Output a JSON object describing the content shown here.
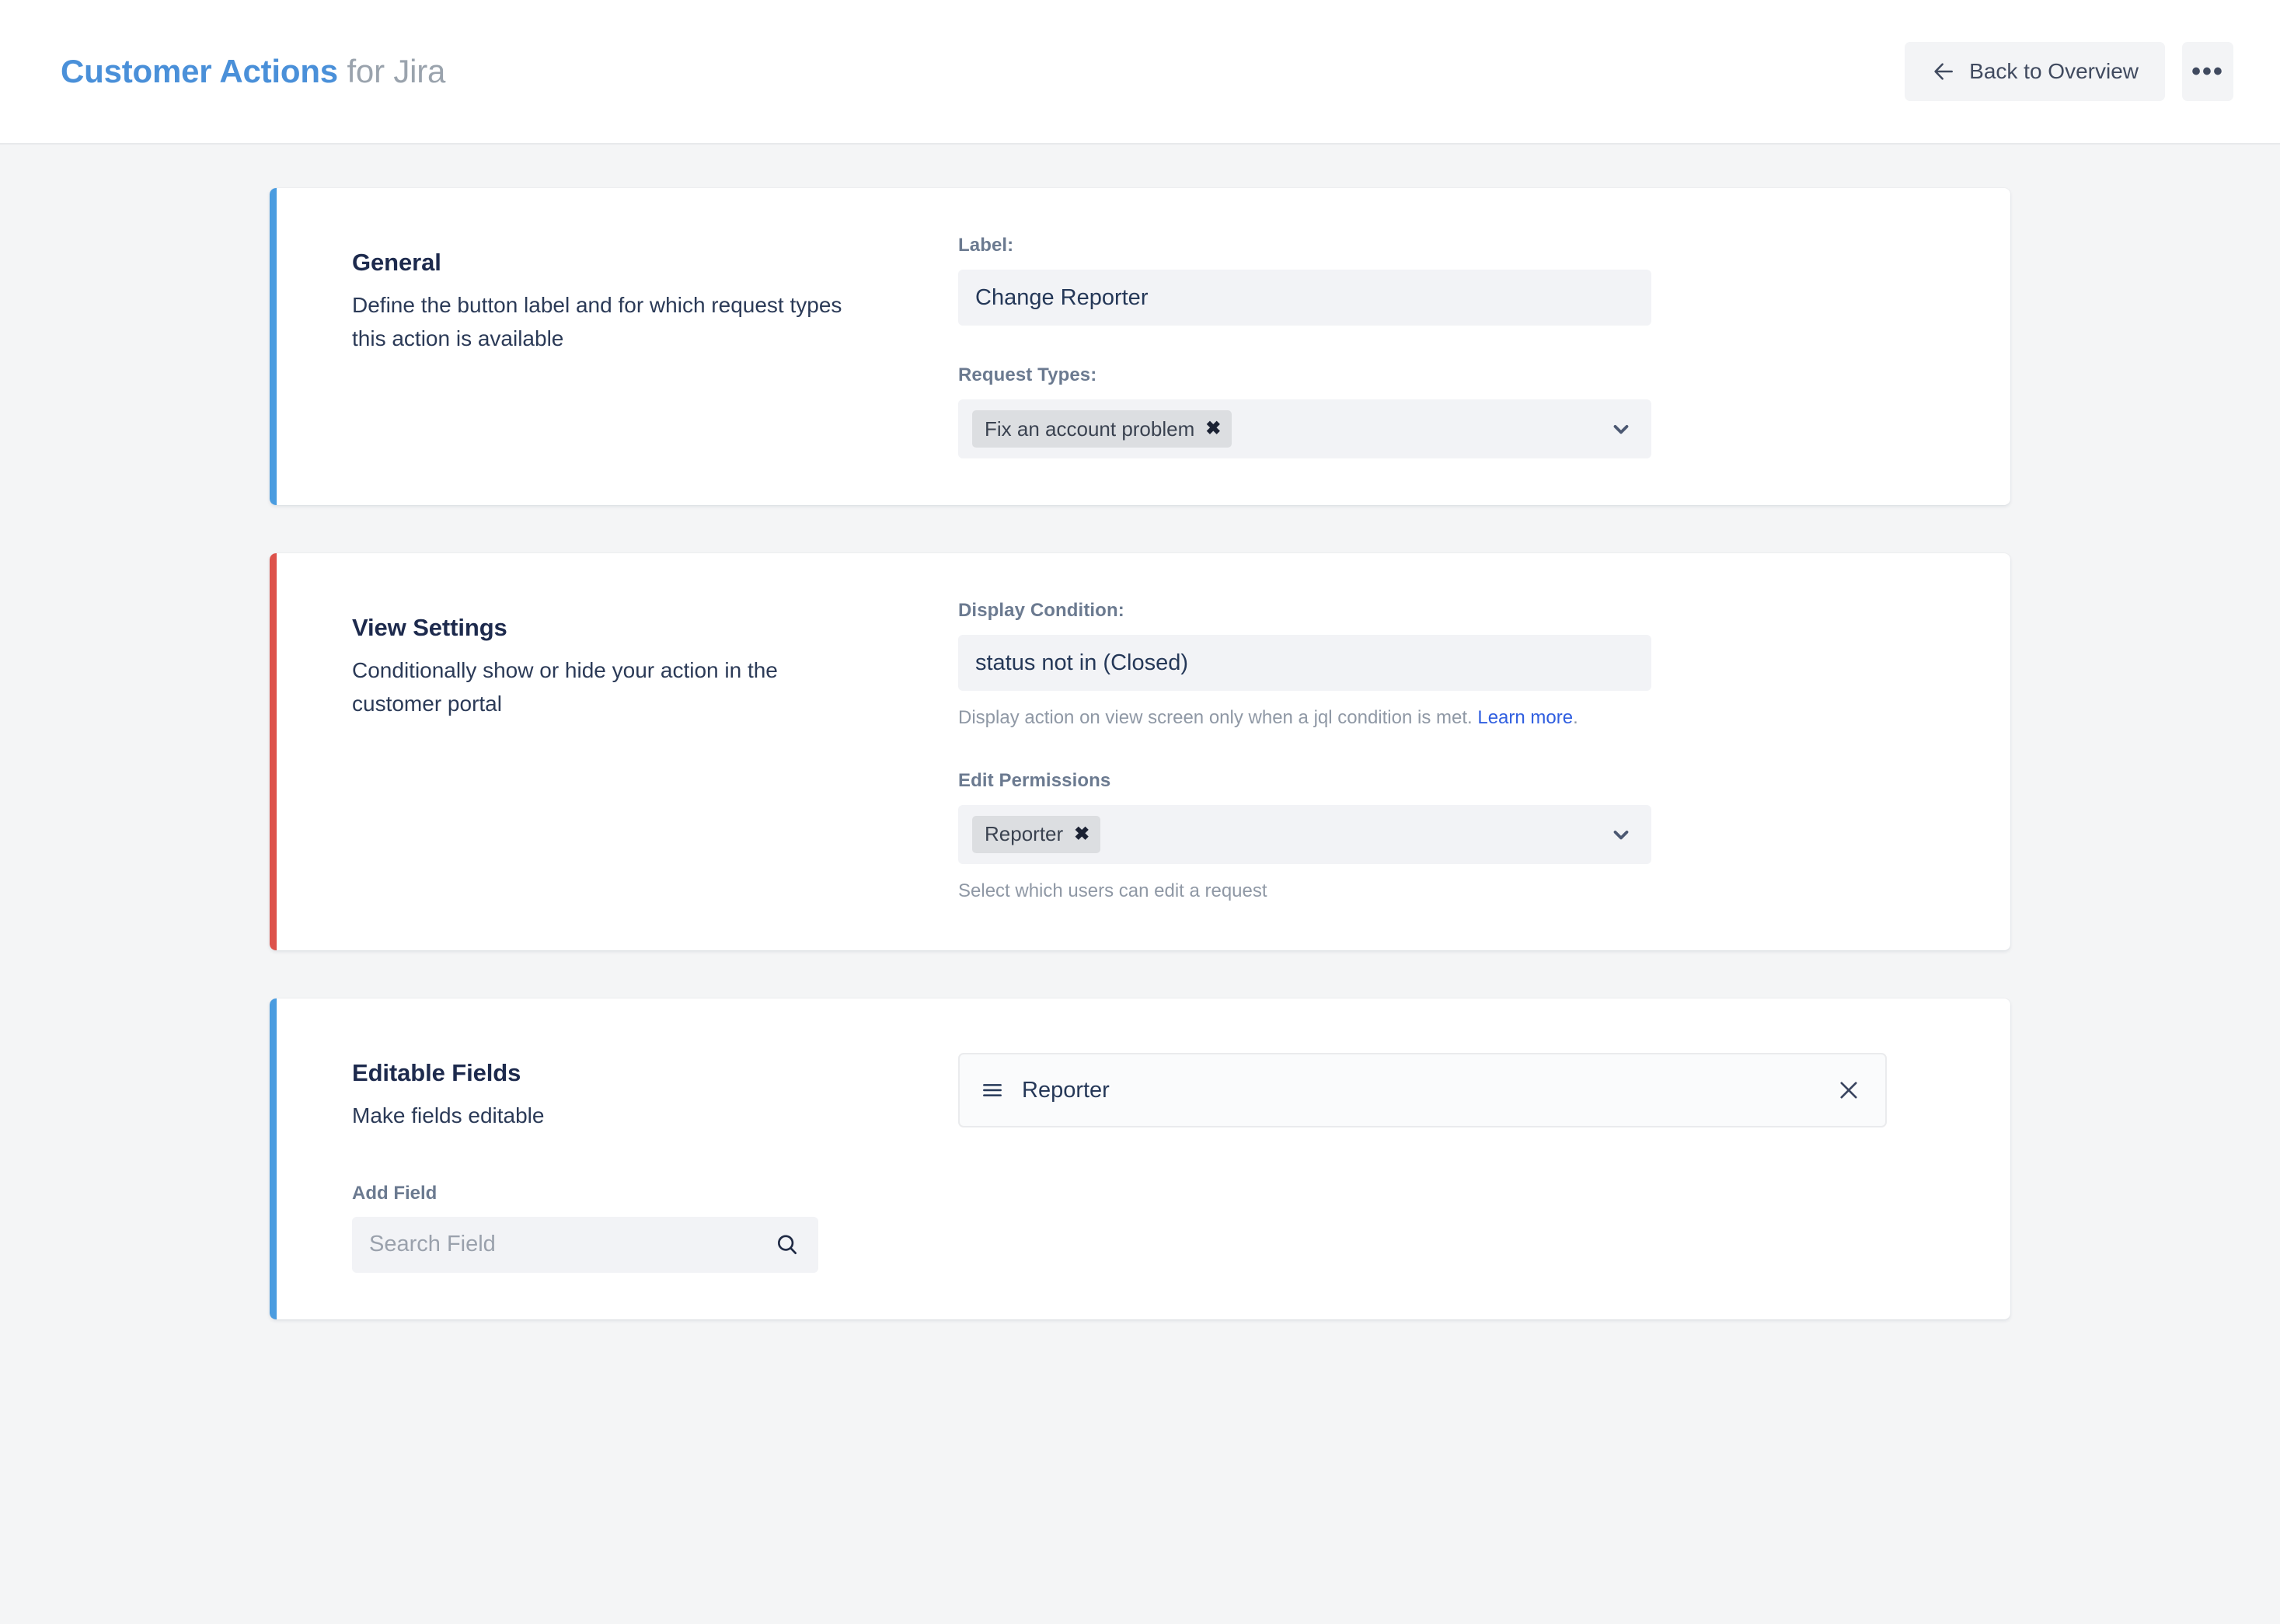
{
  "header": {
    "brand_strong": "Customer Actions",
    "brand_soft": " for Jira",
    "back_button": "Back to Overview",
    "back_icon": "arrow-left-icon",
    "more_icon": "ellipsis-icon",
    "more_label": "•••"
  },
  "cards": {
    "general": {
      "accent_color": "#4a9ce0",
      "title": "General",
      "description": "Define the button label and for which request types this action is available",
      "label_field": {
        "label": "Label:",
        "value": "Change Reporter"
      },
      "request_types_field": {
        "label": "Request Types:",
        "chips": [
          {
            "text": "Fix an account problem",
            "remove": "✖"
          }
        ],
        "chevron": "chevron-down-icon"
      }
    },
    "view_settings": {
      "accent_color": "#dd524b",
      "title": "View Settings",
      "description": "Conditionally show or hide your action in the customer portal",
      "display_condition_field": {
        "label": "Display Condition:",
        "value": "status not in (Closed)",
        "helper_prefix": "Display action on view screen only when a jql condition is met. ",
        "helper_link": "Learn more",
        "helper_suffix": "."
      },
      "edit_permissions_field": {
        "label": "Edit Permissions",
        "chips": [
          {
            "text": "Reporter",
            "remove": "✖"
          }
        ],
        "chevron": "chevron-down-icon",
        "helper": "Select which users can edit a request"
      }
    },
    "editable_fields": {
      "accent_color": "#4a9ce0",
      "title": "Editable Fields",
      "description": "Make fields editable",
      "add_field": {
        "label": "Add Field",
        "placeholder": "Search Field",
        "search_icon": "search-icon"
      },
      "rows": [
        {
          "drag_icon": "drag-handle-icon",
          "label": "Reporter",
          "remove_icon": "close-icon"
        }
      ]
    }
  },
  "colors": {
    "page_background": "#f4f5f6",
    "card_background": "#ffffff",
    "accent_blue": "#4a9ce0",
    "accent_red": "#dd524b",
    "brand_blue": "#4a90d9",
    "brand_gray": "#9aa3ad",
    "input_background": "#f2f3f6",
    "chip_background": "#dcdee1",
    "link_blue": "#2f5ee0",
    "text_dark": "#253858",
    "text_muted": "#8f98a5",
    "label_gray": "#6b7a90"
  }
}
